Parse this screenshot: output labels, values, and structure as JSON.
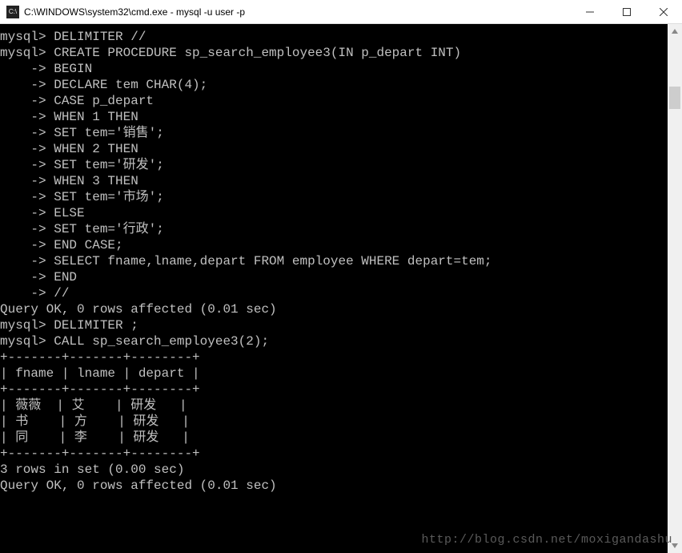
{
  "window": {
    "title": "C:\\WINDOWS\\system32\\cmd.exe - mysql  -u user -p",
    "icon_name": "cmd-icon"
  },
  "term": {
    "lines": [
      "",
      "mysql> DELIMITER //",
      "mysql> CREATE PROCEDURE sp_search_employee3(IN p_depart INT)",
      "    -> BEGIN",
      "    -> DECLARE tem CHAR(4);",
      "    -> CASE p_depart",
      "    -> WHEN 1 THEN",
      "    -> SET tem='销售';",
      "    -> WHEN 2 THEN",
      "    -> SET tem='研发';",
      "    -> WHEN 3 THEN",
      "    -> SET tem='市场';",
      "    -> ELSE",
      "    -> SET tem='行政';",
      "    -> END CASE;",
      "    -> SELECT fname,lname,depart FROM employee WHERE depart=tem;",
      "    -> END",
      "    -> //",
      "Query OK, 0 rows affected (0.01 sec)",
      "",
      "mysql> DELIMITER ;",
      "mysql> CALL sp_search_employee3(2);",
      "+-------+-------+--------+",
      "| fname | lname | depart |",
      "+-------+-------+--------+",
      "| 薇薇  | 艾    | 研发   |",
      "| 书    | 方    | 研发   |",
      "| 同    | 李    | 研发   |",
      "+-------+-------+--------+",
      "3 rows in set (0.00 sec)",
      "",
      "Query OK, 0 rows affected (0.01 sec)"
    ]
  },
  "query_result": {
    "columns": [
      "fname",
      "lname",
      "depart"
    ],
    "rows": [
      {
        "fname": "薇薇",
        "lname": "艾",
        "depart": "研发"
      },
      {
        "fname": "书",
        "lname": "方",
        "depart": "研发"
      },
      {
        "fname": "同",
        "lname": "李",
        "depart": "研发"
      }
    ],
    "rows_in_set": 3,
    "set_time_sec": 0.0,
    "rows_affected": 0,
    "affected_time_sec": 0.01
  },
  "procedure": {
    "name": "sp_search_employee3",
    "param": {
      "name": "p_depart",
      "type": "INT",
      "mode": "IN"
    },
    "case_map": {
      "1": "销售",
      "2": "研发",
      "3": "市场",
      "else": "行政"
    },
    "select_sql": "SELECT fname,lname,depart FROM employee WHERE depart=tem;"
  },
  "watermark": "http://blog.csdn.net/moxigandashu"
}
